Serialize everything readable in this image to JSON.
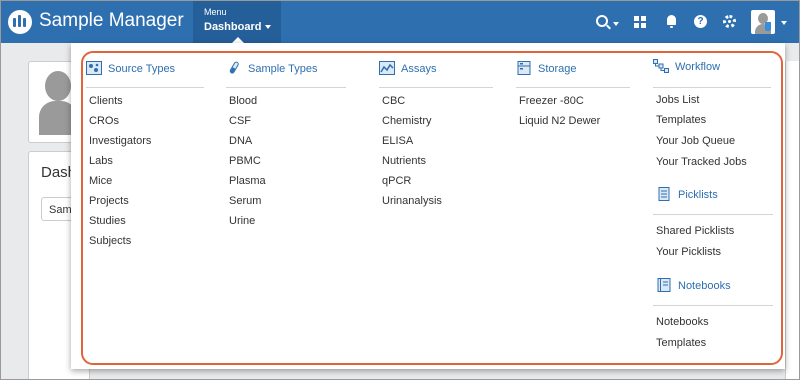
{
  "app": {
    "title": "Sample Manager"
  },
  "menu": {
    "small_label": "Menu",
    "main_label": "Dashboard"
  },
  "help": {
    "glyph": "?"
  },
  "background": {
    "dashboard_label": "Dash",
    "select_value": "Sam"
  },
  "columns": [
    {
      "title": "Source Types",
      "icon": "source-types-icon",
      "items": [
        "Clients",
        "CROs",
        "Investigators",
        "Labs",
        "Mice",
        "Projects",
        "Studies",
        "Subjects"
      ]
    },
    {
      "title": "Sample Types",
      "icon": "test-tube-icon",
      "items": [
        "Blood",
        "CSF",
        "DNA",
        "PBMC",
        "Plasma",
        "Serum",
        "Urine"
      ]
    },
    {
      "title": "Assays",
      "icon": "chart-icon",
      "items": [
        "CBC",
        "Chemistry",
        "ELISA",
        "Nutrients",
        "qPCR",
        "Urinanalysis"
      ]
    },
    {
      "title": "Storage",
      "icon": "storage-icon",
      "items": [
        "Freezer -80C",
        "Liquid N2 Dewer"
      ]
    }
  ],
  "workflow": {
    "title": "Workflow",
    "icon": "workflow-icon",
    "items": [
      "Jobs List",
      "Templates",
      "Your Job Queue",
      "Your Tracked Jobs"
    ]
  },
  "picklists": {
    "title": "Picklists",
    "icon": "picklist-icon",
    "items": [
      "Shared Picklists",
      "Your Picklists"
    ]
  },
  "notebooks": {
    "title": "Notebooks",
    "icon": "notebook-icon",
    "items": [
      "Notebooks",
      "Templates"
    ]
  },
  "colors": {
    "brand": "#2e6fb0",
    "highlight": "#e2643a",
    "link": "#2e6fb0"
  }
}
